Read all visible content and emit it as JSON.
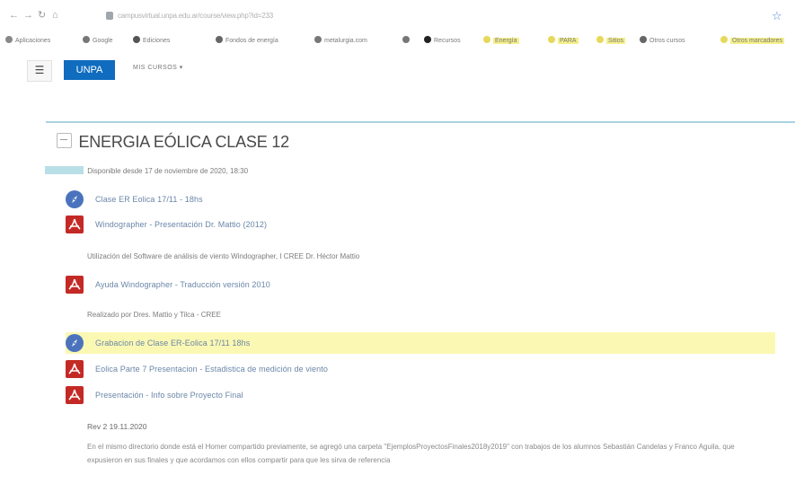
{
  "browser": {
    "url": "campusvirtual.unpa.edu.ar/course/view.php?id=233",
    "bookmarks": [
      {
        "label": "Aplicaciones",
        "icon": "apps-icon",
        "color": "#888888"
      },
      {
        "label": "Google",
        "icon": "doc-icon",
        "color": "#777777"
      },
      {
        "label": "Ediciones",
        "icon": "grid-icon",
        "color": "#555555"
      },
      {
        "label": "Fondos de energía",
        "icon": "globe-icon",
        "color": "#666666"
      },
      {
        "label": "metalurgia.com",
        "icon": "doc-icon",
        "color": "#777777"
      },
      {
        "label": "",
        "icon": "doc-icon",
        "color": "#777777"
      },
      {
        "label": "Recursos",
        "icon": "circle-icon",
        "color": "#222222"
      },
      {
        "label": "Energía",
        "icon": "folder-icon",
        "color": "#e6d95a"
      },
      {
        "label": "PARA",
        "icon": "folder-icon",
        "color": "#e6d95a"
      },
      {
        "label": "Sitios",
        "icon": "folder-icon",
        "color": "#e6d95a"
      },
      {
        "label": "Otros cursos",
        "icon": "globe-icon",
        "color": "#666666"
      },
      {
        "label": "Otros marcadores",
        "icon": "folder-icon",
        "color": "#e6d95a"
      }
    ]
  },
  "nav": {
    "menu_icon": "hamburger-icon",
    "brand": "UNPA",
    "my_courses": "MIS CURSOS ▾"
  },
  "section": {
    "title": "ENERGIA EÓLICA CLASE 12",
    "availability": "Disponible desde 17 de noviembre de 2020, 18:30"
  },
  "activities": [
    {
      "type": "url",
      "icon": "compass-icon",
      "label": "Clase ER Eolica 17/11 - 18hs"
    },
    {
      "type": "pdf",
      "icon": "pdf-icon",
      "label": "Windographer - Presentación Dr. Mattio (2012)",
      "note": "Utilización del Software de análisis de viento Windographer, I CREE Dr. Héctor Mattio"
    },
    {
      "type": "pdf",
      "icon": "pdf-icon",
      "label": "Ayuda Windographer - Traducción versión 2010",
      "note": "Realizado por Dres. Mattio y Tilca - CREE"
    },
    {
      "type": "url",
      "icon": "compass-icon",
      "label": "Grabacion de Clase ER-Eolica 17/11 18hs",
      "highlighted": true
    },
    {
      "type": "pdf",
      "icon": "pdf-icon",
      "label": "Eolica Parte 7 Presentacion - Estadistica de medición de viento"
    },
    {
      "type": "pdf",
      "icon": "pdf-icon",
      "label": "Presentación - Info sobre Proyecto Final"
    }
  ],
  "revision": {
    "title": "Rev 2 19.11.2020",
    "text": "En el mismo directorio donde está el Homer compartido previamente, se agregó una carpeta \"EjemplosProyectosFinales2018y2019\" con trabajos de los alumnos Sebastián Candelas y Franco Aguila, que expusieron en sus finales y que acordamos con ellos compartir para que les sirva de referencia"
  },
  "colors": {
    "brand": "#0f6cbf",
    "link": "#6a86a8",
    "highlight": "#fbf8b3",
    "pdf": "#c42a25",
    "url_icon": "#4b73bd",
    "divider": "#a9d3e0"
  }
}
